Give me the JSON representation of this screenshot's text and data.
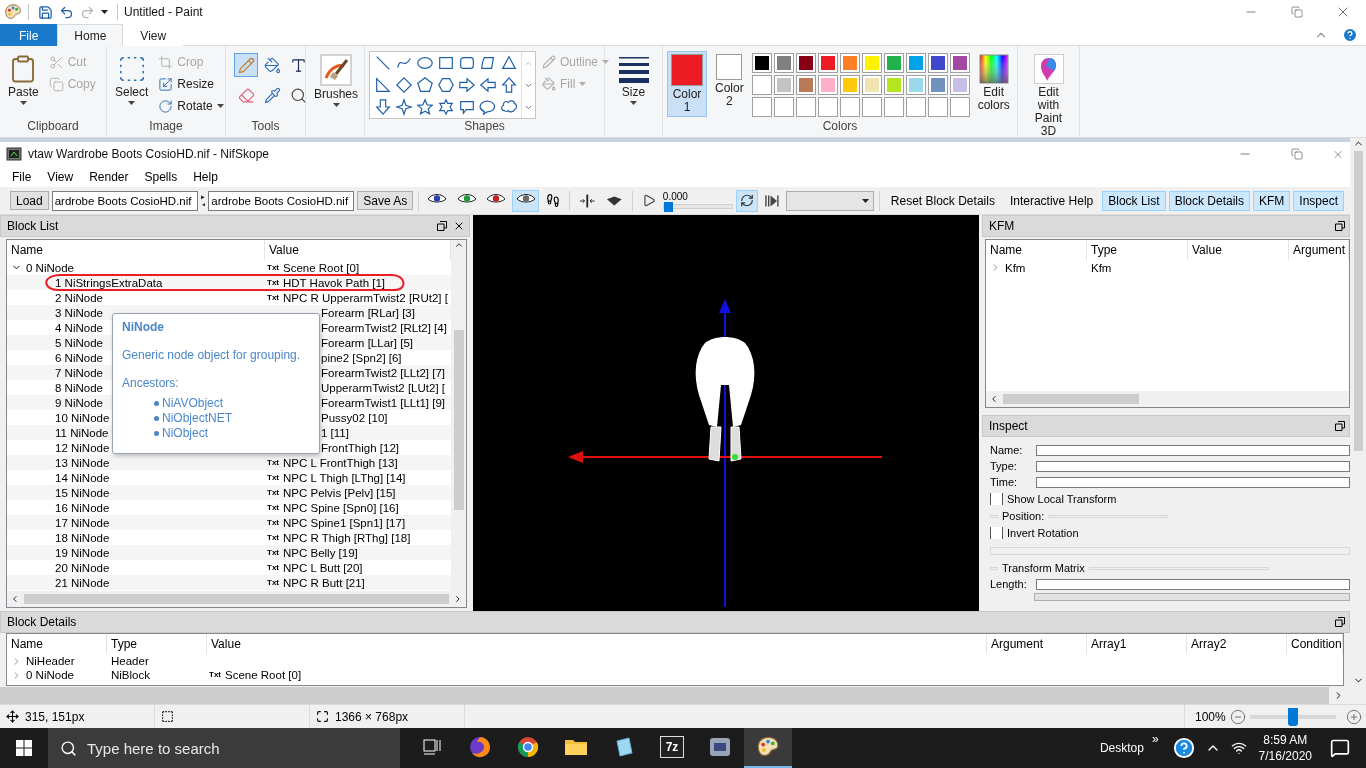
{
  "paint": {
    "title": "Untitled - Paint",
    "quick_access": [
      {
        "kind": "save",
        "disabled": false
      },
      {
        "kind": "undo",
        "disabled": false
      },
      {
        "kind": "redo",
        "disabled": true
      }
    ],
    "tabs": [
      {
        "label": "File",
        "kind": "file",
        "selected": false
      },
      {
        "label": "Home",
        "kind": "tab",
        "selected": true
      },
      {
        "label": "View",
        "kind": "tab",
        "selected": false
      }
    ],
    "ribbon": {
      "clipboard": {
        "title": "Clipboard",
        "paste": "Paste",
        "actions": [
          {
            "label": "Cut",
            "kind": "cut",
            "disabled": true
          },
          {
            "label": "Copy",
            "kind": "copy",
            "disabled": true
          }
        ]
      },
      "image": {
        "title": "Image",
        "select": "Select",
        "actions": [
          {
            "label": "Crop",
            "kind": "crop",
            "disabled": true
          },
          {
            "label": "Resize",
            "kind": "resize",
            "disabled": false
          },
          {
            "label": "Rotate",
            "kind": "rotate",
            "disabled": false
          }
        ]
      },
      "tools": {
        "title": "Tools",
        "items": [
          {
            "kind": "pencil",
            "selected": true
          },
          {
            "kind": "fill",
            "selected": false
          },
          {
            "kind": "text",
            "selected": false
          },
          {
            "kind": "eraser",
            "selected": false
          },
          {
            "kind": "picker",
            "selected": false
          },
          {
            "kind": "magnifier",
            "selected": false
          }
        ]
      },
      "brushes": {
        "label": "Brushes"
      },
      "shapes": {
        "title": "Shapes",
        "outline": {
          "label": "Outline",
          "disabled": true
        },
        "fill": {
          "label": "Fill",
          "disabled": true
        }
      },
      "size": {
        "label": "Size"
      },
      "colors": {
        "title": "Colors",
        "slots": [
          {
            "label": "Color 1",
            "color": "#ed1c24",
            "selected": true
          },
          {
            "label": "Color 2",
            "color": "#ffffff",
            "selected": false
          }
        ],
        "palette": [
          {
            "color": "#000000"
          },
          {
            "color": "#7f7f7f"
          },
          {
            "color": "#880015"
          },
          {
            "color": "#ed1c24"
          },
          {
            "color": "#ff7f27"
          },
          {
            "color": "#fff200"
          },
          {
            "color": "#22b14c"
          },
          {
            "color": "#00a2e8"
          },
          {
            "color": "#3f48cc"
          },
          {
            "color": "#a349a4"
          },
          {
            "color": "#ffffff"
          },
          {
            "color": "#c3c3c3"
          },
          {
            "color": "#b97a57"
          },
          {
            "color": "#ffaec9"
          },
          {
            "color": "#ffc90e"
          },
          {
            "color": "#efe4b0"
          },
          {
            "color": "#b5e61d"
          },
          {
            "color": "#99d9ea"
          },
          {
            "color": "#7092be"
          },
          {
            "color": "#c8bfe7"
          }
        ],
        "edit_colors": "Edit colors"
      },
      "paint3d": "Edit with Paint 3D"
    },
    "status": {
      "cursor": "315, 151px",
      "dimensions": "1366 × 768px",
      "zoom": "100%",
      "zoom_slider": {
        "level": 0.5
      }
    }
  },
  "nifskope": {
    "title": "vtaw Wardrobe Boots CosioHD.nif - NifSkope",
    "menu": [
      "File",
      "View",
      "Render",
      "Spells",
      "Help"
    ],
    "toolbar": {
      "load": "Load",
      "files": [
        "ardrobe Boots CosioHD.nif",
        "ardrobe Boots CosioHD.nif"
      ],
      "save_as": "Save As",
      "view_modes": [
        {
          "color": "#2b3fb0",
          "selected": false
        },
        {
          "color": "#1f9a3a",
          "selected": false
        },
        {
          "color": "#c42020",
          "selected": false
        },
        {
          "color": "#6a6a6a",
          "selected": true
        }
      ],
      "time": "0.000",
      "time_slider": {
        "level": 0.0
      },
      "loop": {
        "selected": true
      },
      "actions": [
        "Reset Block Details",
        "Interactive Help"
      ],
      "docks": [
        {
          "label": "Block List",
          "selected": true
        },
        {
          "label": "Block Details",
          "selected": true
        },
        {
          "label": "KFM",
          "selected": true
        },
        {
          "label": "Inspect",
          "selected": true
        }
      ]
    },
    "block_list": {
      "title": "Block List",
      "columns": [
        "Name",
        "Value"
      ],
      "rows": [
        {
          "name": "0 NiNode",
          "tag": "Txt",
          "value": "Scene Root [0]",
          "expanded": true,
          "children": [
            {
              "name": "1 NiStringsExtraData",
              "tag": "Txt",
              "value": "HDT Havok Path [1]",
              "covered": false
            },
            {
              "name": "2 NiNode",
              "tag": "Txt",
              "value": "NPC R UpperarmTwist2 [RUt2] [",
              "covered": false
            },
            {
              "name": "3 NiNode",
              "value": "Forearm [RLar] [3]",
              "covered": true
            },
            {
              "name": "4 NiNode",
              "value": "ForearmTwist2 [RLt2] [4]",
              "covered": true
            },
            {
              "name": "5 NiNode",
              "value": "Forearm [LLar] [5]",
              "covered": true
            },
            {
              "name": "6 NiNode",
              "value": "pine2 [Spn2] [6]",
              "covered": true
            },
            {
              "name": "7 NiNode",
              "value": "ForearmTwist2 [LLt2] [7]",
              "covered": true
            },
            {
              "name": "8 NiNode",
              "value": "UpperarmTwist2 [LUt2] [",
              "covered": true
            },
            {
              "name": "9 NiNode",
              "value": "ForearmTwist1 [LLt1] [9]",
              "covered": true
            },
            {
              "name": "10 NiNode",
              "value": "Pussy02 [10]",
              "covered": true
            },
            {
              "name": "11 NiNode",
              "value": "1 [11]",
              "covered": true
            },
            {
              "name": "12 NiNode",
              "value": "FrontThigh [12]",
              "covered": true
            },
            {
              "name": "13 NiNode",
              "tag": "Txt",
              "value": "NPC L FrontThigh [13]",
              "covered": false
            },
            {
              "name": "14 NiNode",
              "tag": "Txt",
              "value": "NPC L Thigh [LThg] [14]",
              "covered": false
            },
            {
              "name": "15 NiNode",
              "tag": "Txt",
              "value": "NPC Pelvis [Pelv] [15]",
              "covered": false
            },
            {
              "name": "16 NiNode",
              "tag": "Txt",
              "value": "NPC Spine [Spn0] [16]",
              "covered": false
            },
            {
              "name": "17 NiNode",
              "tag": "Txt",
              "value": "NPC Spine1 [Spn1] [17]",
              "covered": false
            },
            {
              "name": "18 NiNode",
              "tag": "Txt",
              "value": "NPC R Thigh [RThg] [18]",
              "covered": false
            },
            {
              "name": "19 NiNode",
              "tag": "Txt",
              "value": "NPC Belly [19]",
              "covered": false
            },
            {
              "name": "20 NiNode",
              "tag": "Txt",
              "value": "NPC L Butt [20]",
              "covered": false
            },
            {
              "name": "21 NiNode",
              "tag": "Txt",
              "value": "NPC R Butt [21]",
              "covered": false
            }
          ]
        }
      ]
    },
    "tooltip": {
      "title": "NiNode",
      "description": "Generic node object for grouping.",
      "ancestors_label": "Ancestors:",
      "ancestors": [
        "NiAVObject",
        "NiObjectNET",
        "NiObject"
      ]
    },
    "kfm": {
      "title": "KFM",
      "columns": [
        "Name",
        "Type",
        "Value",
        "Argument"
      ],
      "rows": [
        {
          "name": "Kfm",
          "type": "Kfm",
          "expanded": false
        }
      ]
    },
    "inspect": {
      "title": "Inspect",
      "fields": [
        "Name:",
        "Type:",
        "Time:"
      ],
      "show_local": {
        "label": "Show Local Transform",
        "checked": false
      },
      "position": "Position:",
      "invert": {
        "label": "Invert Rotation",
        "checked": false
      },
      "matrix": "Transform Matrix",
      "length": "Length:"
    },
    "block_details": {
      "title": "Block Details",
      "columns": [
        "Name",
        "Type",
        "Value",
        "Argument",
        "Array1",
        "Array2",
        "Condition"
      ],
      "rows": [
        {
          "name": "NiHeader",
          "type": "Header",
          "expanded": false
        },
        {
          "name": "0 NiNode",
          "type": "NiBlock",
          "tag": "Txt",
          "value": "Scene Root [0]",
          "expanded": false
        }
      ]
    }
  },
  "taskbar": {
    "search": "Type here to search",
    "apps": [
      {
        "kind": "taskview",
        "selected": false
      },
      {
        "kind": "firefox",
        "selected": false
      },
      {
        "kind": "chrome",
        "selected": false
      },
      {
        "kind": "explorer",
        "selected": false
      },
      {
        "kind": "notes",
        "selected": false
      },
      {
        "kind": "archive",
        "label": "7z",
        "selected": false
      },
      {
        "kind": "games",
        "selected": false
      },
      {
        "kind": "paint",
        "selected": true
      }
    ],
    "desktop": "Desktop",
    "more": "»",
    "time": "8:59 AM",
    "date": "7/16/2020"
  }
}
